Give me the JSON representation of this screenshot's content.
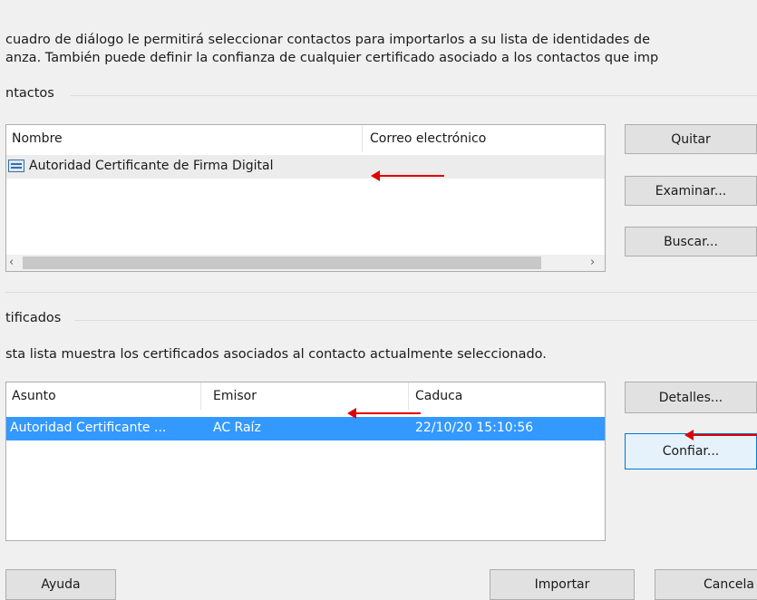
{
  "intro": {
    "line1": "cuadro de diálogo le permitirá seleccionar contactos para importarlos a su lista de identidades de",
    "line2": "anza. También puede definir la confianza de cualquier certificado asociado a los contactos que imp"
  },
  "contacts": {
    "label": "ntactos",
    "columns": {
      "name": "Nombre",
      "email": "Correo electrónico"
    },
    "rows": [
      {
        "name": "Autoridad Certificante de Firma Digital",
        "email": "",
        "icon": "certificate-contact-icon"
      }
    ],
    "buttons": {
      "remove": "Quitar",
      "browse": "Examinar...",
      "search": "Buscar..."
    }
  },
  "certificates": {
    "label": "tificados",
    "description": "sta lista muestra los certificados asociados al contacto actualmente seleccionado.",
    "columns": {
      "subject": "Asunto",
      "issuer": "Emisor",
      "expires": "Caduca"
    },
    "rows": [
      {
        "subject": "Autoridad Certificante ...",
        "issuer": "AC Raíz",
        "expires": "22/10/20 15:10:56",
        "selected": true
      }
    ],
    "buttons": {
      "details": "Detalles...",
      "trust": "Confiar..."
    }
  },
  "footer": {
    "help": "Ayuda",
    "import": "Importar",
    "cancel": "Cancela"
  },
  "colors": {
    "selection": "#3399ff",
    "annotation_arrow": "#e00000",
    "focus_border": "#0078d7"
  }
}
